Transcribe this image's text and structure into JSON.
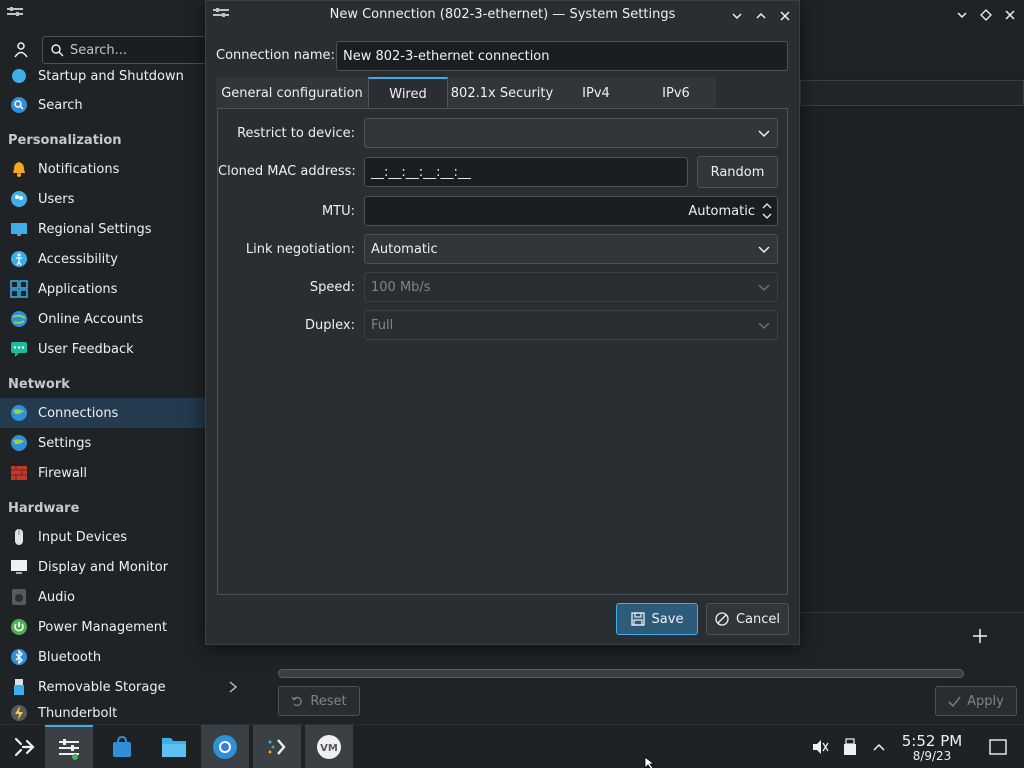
{
  "background": {
    "search": {
      "placeholder": "Search..."
    },
    "sidebar": {
      "items_top": [
        {
          "label": "Startup and Shutdown",
          "icon": "power-icon"
        },
        {
          "label": "Search",
          "icon": "search-icon"
        }
      ],
      "categories": {
        "personalization": "Personalization",
        "network": "Network",
        "hardware": "Hardware"
      },
      "personalization": [
        {
          "label": "Notifications",
          "icon": "bell-icon"
        },
        {
          "label": "Users",
          "icon": "users-icon"
        },
        {
          "label": "Regional Settings",
          "icon": "monitor-flag-icon"
        },
        {
          "label": "Accessibility",
          "icon": "accessibility-icon"
        },
        {
          "label": "Applications",
          "icon": "apps-grid-icon"
        },
        {
          "label": "Online Accounts",
          "icon": "globe-user-icon"
        },
        {
          "label": "User Feedback",
          "icon": "feedback-icon"
        }
      ],
      "network": [
        {
          "label": "Connections",
          "icon": "globe-icon",
          "selected": true
        },
        {
          "label": "Settings",
          "icon": "globe-icon"
        },
        {
          "label": "Firewall",
          "icon": "firewall-icon"
        }
      ],
      "hardware": [
        {
          "label": "Input Devices",
          "icon": "mouse-icon"
        },
        {
          "label": "Display and Monitor",
          "icon": "display-icon"
        },
        {
          "label": "Audio",
          "icon": "speaker-icon"
        },
        {
          "label": "Power Management",
          "icon": "power-green-icon"
        },
        {
          "label": "Bluetooth",
          "icon": "bluetooth-icon"
        },
        {
          "label": "Removable Storage",
          "icon": "usb-icon"
        },
        {
          "label": "Thunderbolt",
          "icon": "thunderbolt-icon"
        }
      ]
    },
    "buttons": {
      "reset": "Reset",
      "apply": "Apply"
    }
  },
  "dialog": {
    "title": "New Connection (802-3-ethernet) — System Settings",
    "connection_name_label": "Connection name:",
    "connection_name_value": "New 802-3-ethernet connection",
    "tabs": [
      {
        "label": "General configuration",
        "active": false
      },
      {
        "label": "Wired",
        "active": true
      },
      {
        "label": "802.1x Security",
        "active": false
      },
      {
        "label": "IPv4",
        "active": false
      },
      {
        "label": "IPv6",
        "active": false
      }
    ],
    "wired": {
      "restrict_label": "Restrict to device:",
      "restrict_value": "",
      "mac_label": "Cloned MAC address:",
      "mac_value": "__:__:__:__:__:__",
      "random_button": "Random",
      "mtu_label": "MTU:",
      "mtu_value": "Automatic",
      "link_label": "Link negotiation:",
      "link_value": "Automatic",
      "speed_label": "Speed:",
      "speed_value": "100 Mb/s",
      "duplex_label": "Duplex:",
      "duplex_value": "Full"
    },
    "save_button": "Save",
    "cancel_button": "Cancel"
  },
  "taskbar": {
    "clock_time": "5:52 PM",
    "clock_date": "8/9/23"
  },
  "colors": {
    "accent": "#3daee9",
    "window_bg": "#2a2e32",
    "selected_bg": "#233a4f"
  }
}
